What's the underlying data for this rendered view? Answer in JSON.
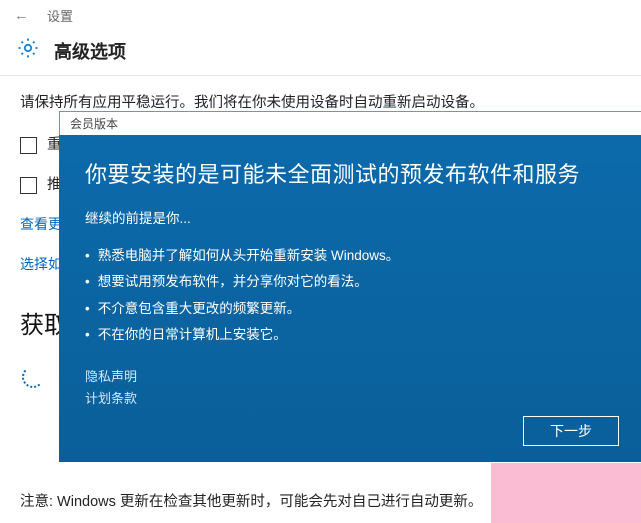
{
  "titlebar": {
    "app": "设置"
  },
  "page": {
    "title": "高级选项"
  },
  "intro": "请保持所有应用平稳运行。我们将在你未使用设备时自动重新启动设备。",
  "checkbox1_partial": "重",
  "checkbox2_partial": "推",
  "link_view": "查看更",
  "link_select": "选择如",
  "section_get": "获取",
  "note": "注意: Windows 更新在检查其他更新时，可能会先对自己进行自动更新。",
  "dialog": {
    "window_title": "会员版本",
    "title": "你要安装的是可能未全面测试的预发布软件和服务",
    "subtitle": "继续的前提是你...",
    "bullets": [
      "熟悉电脑并了解如何从头开始重新安装 Windows。",
      "想要试用预发布软件，并分享你对它的看法。",
      "不介意包含重大更改的频繁更新。",
      "不在你的日常计算机上安装它。"
    ],
    "privacy": "隐私声明",
    "terms": "计划条款",
    "next_btn": "下一步"
  }
}
